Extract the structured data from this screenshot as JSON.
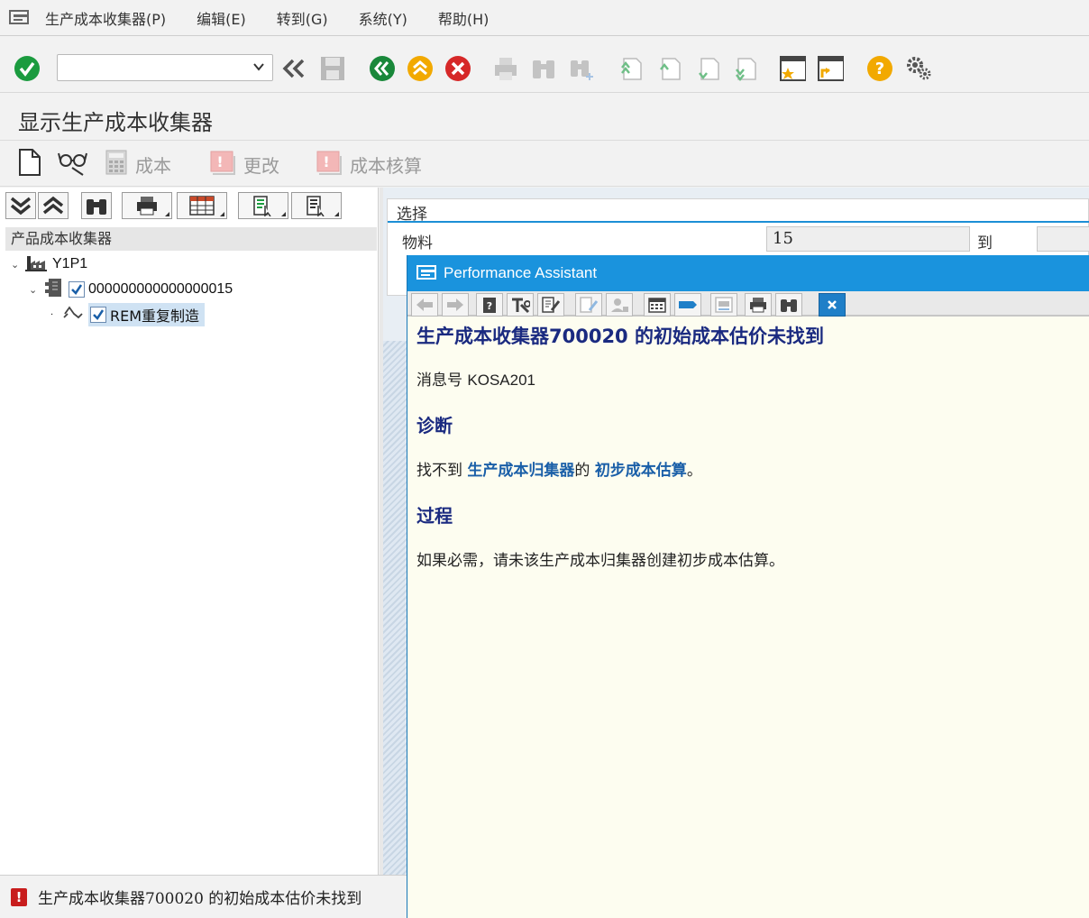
{
  "menu": {
    "items": [
      "生产成本收集器(P)",
      "编辑(E)",
      "转到(G)",
      "系统(Y)",
      "帮助(H)"
    ]
  },
  "toolbar": {
    "command_value": ""
  },
  "title": "显示生产成本收集器",
  "app_toolbar": {
    "cost_label": "成本",
    "change_label": "更改",
    "costing_label": "成本核算"
  },
  "tree": {
    "header": "产品成本收集器",
    "plant": "Y1P1",
    "material": "000000000000000015",
    "collector": "REM重复制造"
  },
  "selection": {
    "title": "选择",
    "material_label": "物料",
    "material_value": "15",
    "to_label": "到"
  },
  "assistant": {
    "title": "Performance Assistant",
    "heading": "生产成本收集器700020 的初始成本估价未找到",
    "msg_label": "消息号",
    "msg_code": "KOSA201",
    "diag_title": "诊断",
    "diag_prefix": "找不到 ",
    "diag_link1": "生产成本归集器",
    "diag_mid": "的 ",
    "diag_link2": "初步成本估算",
    "diag_suffix": "。",
    "proc_title": "过程",
    "proc_text": "如果必需，请未该生产成本归集器创建初步成本估算。"
  },
  "status": {
    "text": "生产成本收集器700020 的初始成本估价未找到"
  },
  "colors": {
    "accent": "#1a93dd",
    "ok_green": "#1b9b3f",
    "nav_green": "#19883a",
    "exit_yellow": "#f2a900",
    "cancel_red": "#d62828",
    "help_yellow": "#f2a900"
  }
}
